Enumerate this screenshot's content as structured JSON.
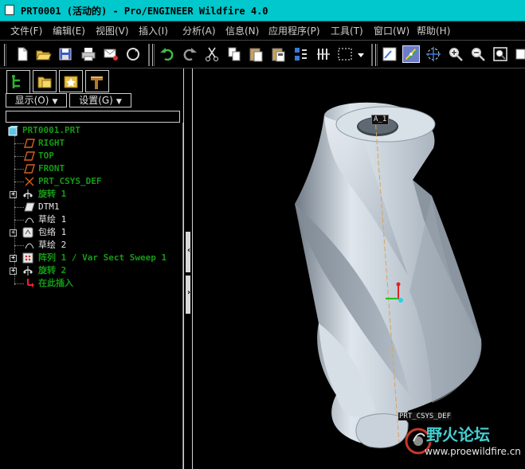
{
  "window": {
    "title": "PRT0001 (活动的) - Pro/ENGINEER Wildfire 4.0"
  },
  "menu": [
    "文件(F)",
    "编辑(E)",
    "视图(V)",
    "插入(I)",
    "分析(A)",
    "信息(N)",
    "应用程序(P)",
    "工具(T)",
    "窗口(W)",
    "帮助(H)"
  ],
  "toolbar": {
    "icons": [
      "new-file-icon",
      "open-folder-icon",
      "save-icon",
      "print-icon",
      "send-mail-icon",
      "redraw-icon",
      "undo-icon",
      "redo-icon",
      "cut-icon",
      "copy-icon",
      "paste-icon",
      "paste-special-icon",
      "regenerate-icon",
      "edit-relations-icon",
      "select-box-icon",
      "select-dropdown-icon",
      "repaint-icon",
      "spin-center-icon",
      "orient-mode-icon",
      "zoom-in-icon",
      "zoom-out-icon",
      "refit-icon",
      "saved-views-icon"
    ]
  },
  "navigator": {
    "tabs": [
      "model-tree-tab-icon",
      "folder-browser-tab-icon",
      "favorites-tab-icon",
      "connections-tab-icon"
    ],
    "show_label": "显示(O)",
    "settings_label": "设置(G)",
    "tree": [
      {
        "label": "PRT0001.PRT",
        "icon": "part-icon"
      },
      {
        "label": "RIGHT",
        "icon": "datum-plane-icon"
      },
      {
        "label": "TOP",
        "icon": "datum-plane-icon"
      },
      {
        "label": "FRONT",
        "icon": "datum-plane-icon"
      },
      {
        "label": "PRT_CSYS_DEF",
        "icon": "coordinate-system-icon"
      },
      {
        "label": "旋转 1",
        "icon": "revolve-icon"
      },
      {
        "label": "DTM1",
        "icon": "datum-plane-icon"
      },
      {
        "label": "草绘 1",
        "icon": "sketch-icon"
      },
      {
        "label": "包络 1",
        "icon": "wrap-icon"
      },
      {
        "label": "草绘 2",
        "icon": "sketch-icon"
      },
      {
        "label": "阵列 1 / Var Sect Sweep 1",
        "icon": "pattern-icon"
      },
      {
        "label": "旋转 2",
        "icon": "revolve-icon"
      },
      {
        "label": "在此插入",
        "icon": "insert-here-arrow-icon"
      }
    ]
  },
  "viewport": {
    "axis_label": "A_1",
    "csys_label": "PRT_CSYS_DEF",
    "model_color": "#b4bfca",
    "axis_color": "#d7a35c",
    "background": "#000000"
  },
  "watermark": {
    "brand": "野火论坛",
    "url": "www.proewildfire.cn"
  },
  "colors": {
    "titlebar": "#00c8cc",
    "tree_feature_text": "#159b15",
    "tree_datum_icon": "#d7601e"
  }
}
